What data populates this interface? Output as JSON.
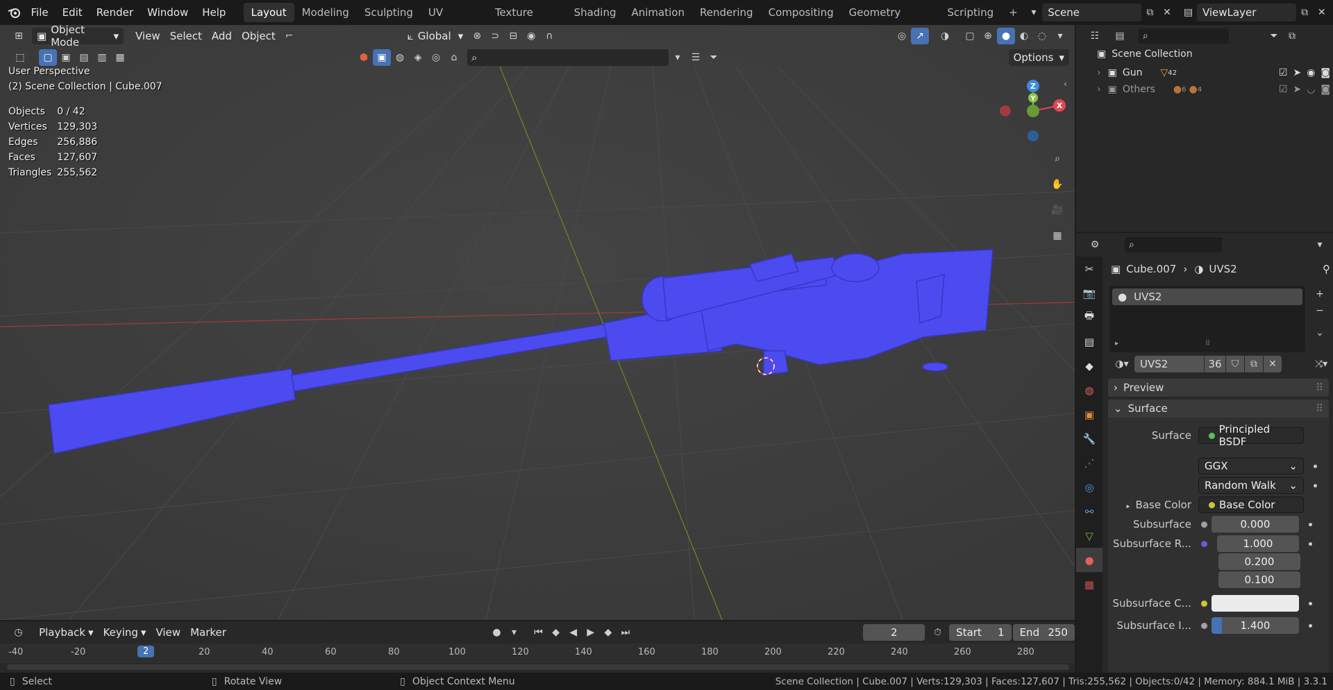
{
  "topbar": {
    "menus": [
      "File",
      "Edit",
      "Render",
      "Window",
      "Help"
    ],
    "workspaces": [
      "Layout",
      "Modeling",
      "Sculpting",
      "UV Editing",
      "Texture Paint",
      "Shading",
      "Animation",
      "Rendering",
      "Compositing",
      "Geometry Nodes",
      "Scripting"
    ],
    "active_workspace": "Layout",
    "add_tab": "+",
    "scene": "Scene",
    "view_layer": "ViewLayer"
  },
  "viewport_header": {
    "mode": "Object Mode",
    "menus": [
      "View",
      "Select",
      "Add",
      "Object"
    ],
    "orientation": "Global",
    "options": "Options"
  },
  "overlay": {
    "view_name": "User Perspective",
    "collection_path": "(2) Scene Collection | Cube.007",
    "stats": [
      {
        "label": "Objects",
        "value": "0 / 42"
      },
      {
        "label": "Vertices",
        "value": "129,303"
      },
      {
        "label": "Edges",
        "value": "256,886"
      },
      {
        "label": "Faces",
        "value": "127,607"
      },
      {
        "label": "Triangles",
        "value": "255,562"
      }
    ]
  },
  "gizmo": {
    "z": "Z",
    "y": "Y",
    "x": "X"
  },
  "timeline": {
    "menus": [
      "Playback",
      "Keying",
      "View",
      "Marker"
    ],
    "current_frame": "2",
    "start_label": "Start",
    "start": "1",
    "end_label": "End",
    "end": "250",
    "ruler": [
      "-40",
      "-20",
      "2",
      "20",
      "40",
      "60",
      "80",
      "100",
      "120",
      "140",
      "160",
      "180",
      "200",
      "220",
      "240",
      "260",
      "280"
    ]
  },
  "statusbar": {
    "select": "Select",
    "rotate": "Rotate View",
    "context": "Object Context Menu",
    "info": "Scene Collection | Cube.007 | Verts:129,303 | Faces:127,607 | Tris:255,562 | Objects:0/42 | Memory: 884.1 MiB | 3.3.1"
  },
  "outliner": {
    "root": "Scene Collection",
    "items": [
      {
        "name": "Gun",
        "badge": "42"
      },
      {
        "name": "Others",
        "badge1": "6",
        "badge2": "4"
      }
    ]
  },
  "properties": {
    "object": "Cube.007",
    "material": "UVS2",
    "slot": "UVS2",
    "mat_name": "UVS2",
    "users": "36",
    "panels": {
      "preview": "Preview",
      "surface": "Surface"
    },
    "surface_label": "Surface",
    "surface_value": "Principled BSDF",
    "distribution": "GGX",
    "subsurface_method": "Random Walk",
    "base_color_label": "Base Color",
    "base_color_value": "Base Color",
    "subsurface_label": "Subsurface",
    "subsurface_value": "0.000",
    "subsurface_radius_label": "Subsurface R...",
    "subsurface_radius": [
      "1.000",
      "0.200",
      "0.100"
    ],
    "subsurface_color_label": "Subsurface C...",
    "subsurface_ior_label": "Subsurface I...",
    "subsurface_ior": "1.400"
  },
  "colors": {
    "model": "#4b4bf0",
    "accent": "#4772b3",
    "x_axis": "#e2464f",
    "y_axis": "#8bc34a",
    "z_axis": "#3d8be2"
  }
}
